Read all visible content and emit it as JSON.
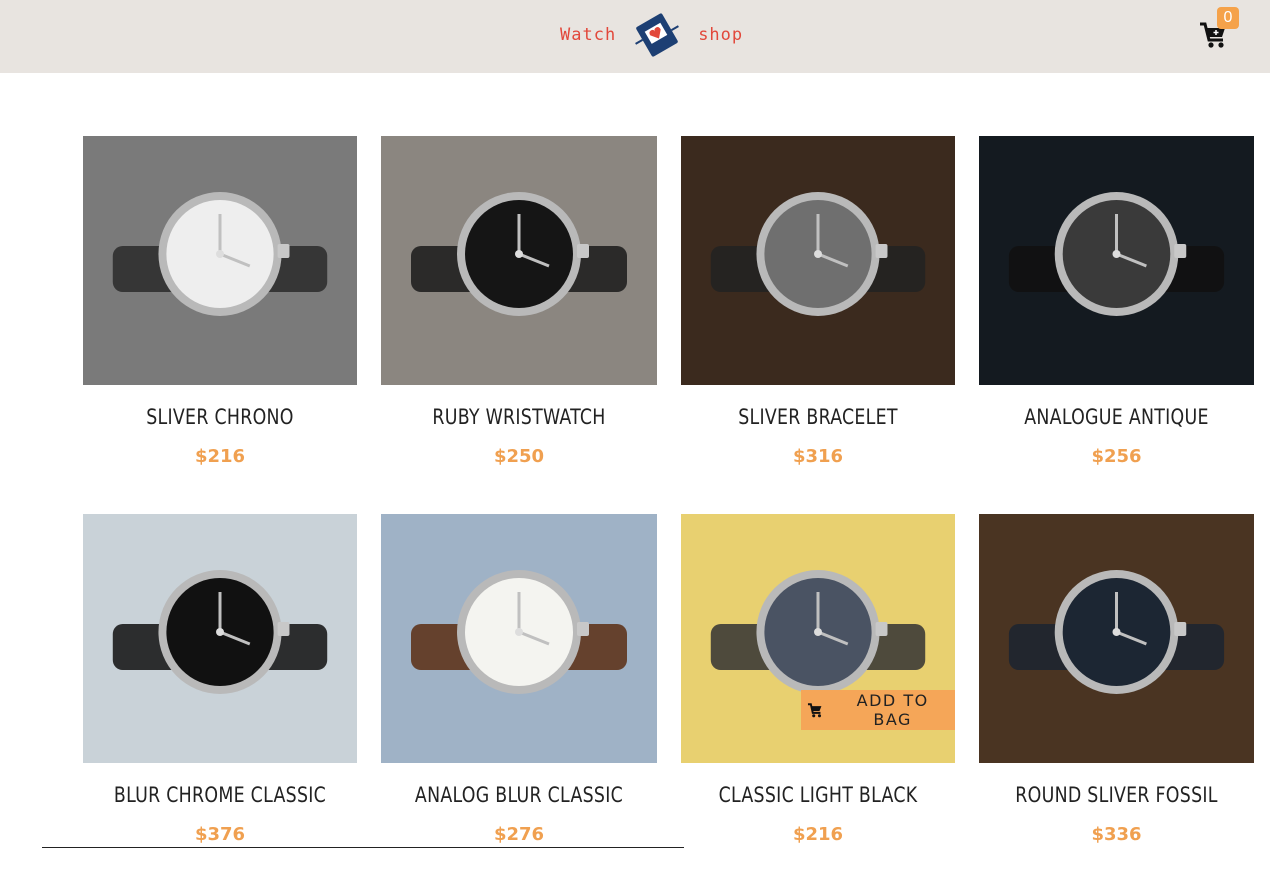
{
  "navbar": {
    "brand_left": "Watch",
    "brand_right": "shop",
    "cart_count": "0"
  },
  "products": [
    {
      "name": "SLIVER CHRONO",
      "price": "$216",
      "bg": "#7a7a7a"
    },
    {
      "name": "RUBY WRISTWATCH",
      "price": "$250",
      "bg": "#8b8680"
    },
    {
      "name": "SLIVER BRACELET",
      "price": "$316",
      "bg": "#3b2a1e"
    },
    {
      "name": "ANALOGUE ANTIQUE",
      "price": "$256",
      "bg": "#141a20"
    },
    {
      "name": "BLUR CHROME CLASSIC",
      "price": "$376",
      "bg": "#c9d2d8"
    },
    {
      "name": "ANALOG BLUR CLASSIC",
      "price": "$276",
      "bg": "#9fb2c6"
    },
    {
      "name": "CLASSIC LIGHT BLACK",
      "price": "$216",
      "bg": "#e8d070"
    },
    {
      "name": "ROUND SLIVER FOSSIL",
      "price": "$336",
      "bg": "#4a3422"
    }
  ],
  "add_to_bag_label": "ADD TO BAG",
  "colors": {
    "accent": "#f5a658",
    "brand": "#e2483b",
    "navbar_bg": "#e8e4e0"
  }
}
